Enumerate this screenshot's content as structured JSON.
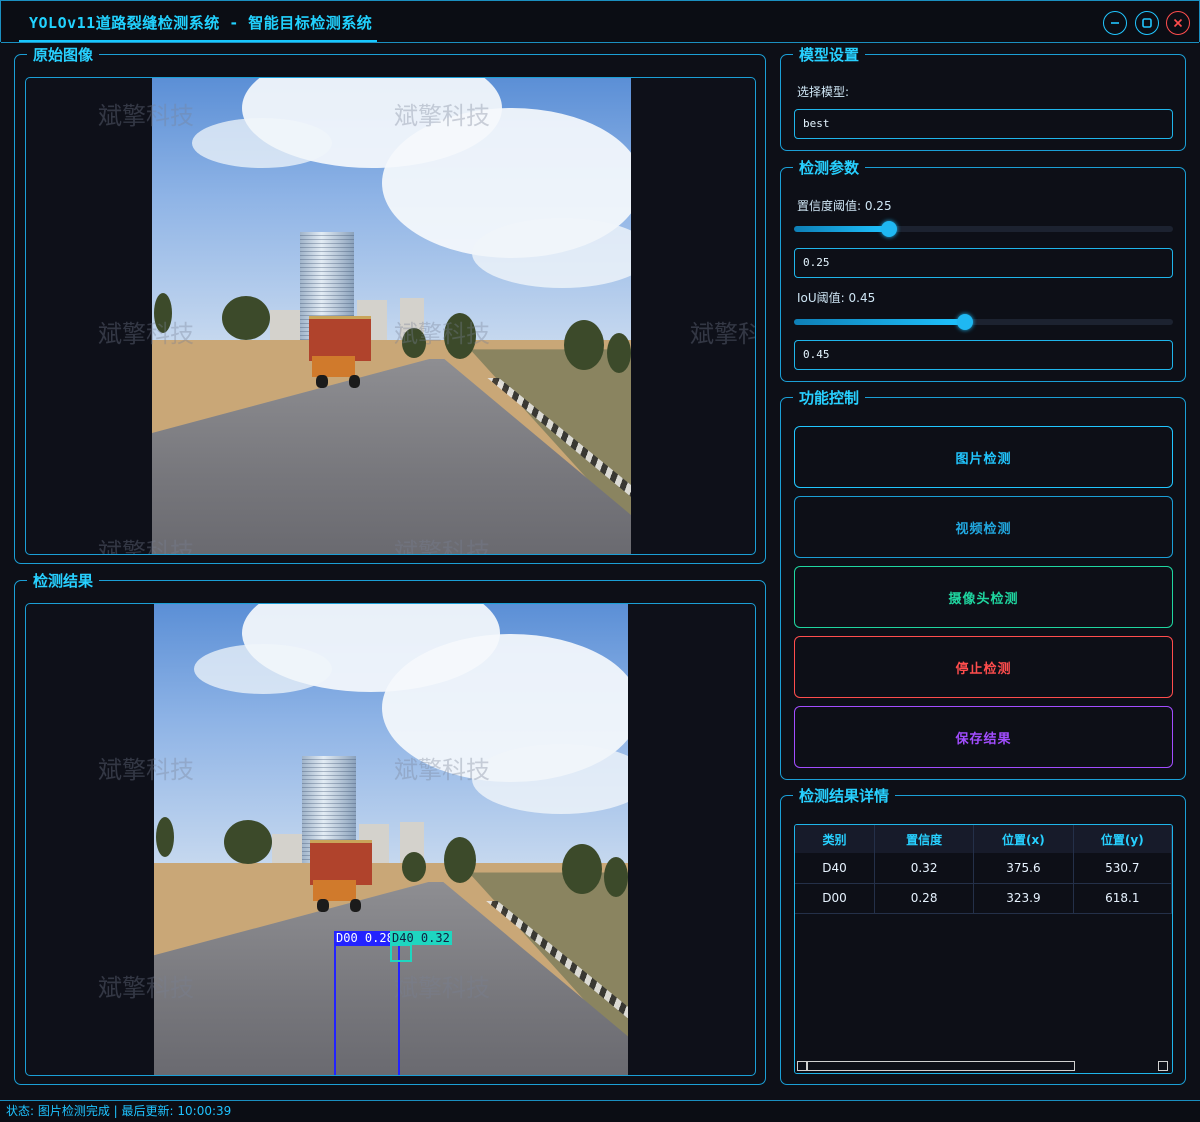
{
  "window": {
    "title": "YOLOv11道路裂缝检测系统 - 智能目标检测系统",
    "min_icon": "minimize-icon",
    "max_icon": "maximize-icon",
    "close_icon": "close-icon"
  },
  "original_panel": {
    "title": "原始图像"
  },
  "result_panel": {
    "title": "检测结果"
  },
  "watermark": "斌擎科技",
  "detections": [
    {
      "label": "D00 0.28",
      "color": "#2323ff"
    },
    {
      "label": "D40 0.32",
      "color": "#1fd6c0"
    }
  ],
  "model_settings": {
    "title": "模型设置",
    "select_label": "选择模型:",
    "selected_model": "best"
  },
  "detect_params": {
    "title": "检测参数",
    "conf_label": "置信度阈值: 0.25",
    "conf_value": "0.25",
    "conf_level": 0.25,
    "iou_label": "IoU阈值: 0.45",
    "iou_value": "0.45",
    "iou_level": 0.45
  },
  "controls": {
    "title": "功能控制",
    "image_detect": "图片检测",
    "video_detect": "视频检测",
    "camera_detect": "摄像头检测",
    "stop_detect": "停止检测",
    "save_result": "保存结果",
    "colors": {
      "image": "#21c6ff",
      "video": "#1b9fd6",
      "camera": "#1fd6a0",
      "stop": "#ff4d4d",
      "save": "#a24dff"
    }
  },
  "results": {
    "title": "检测结果详情",
    "columns": [
      "类别",
      "置信度",
      "位置(x)",
      "位置(y)"
    ],
    "rows": [
      [
        "D40",
        "0.32",
        "375.6",
        "530.7"
      ],
      [
        "D00",
        "0.28",
        "323.9",
        "618.1"
      ]
    ]
  },
  "status": {
    "text": "状态: 图片检测完成 | 最后更新: 10:00:39"
  }
}
